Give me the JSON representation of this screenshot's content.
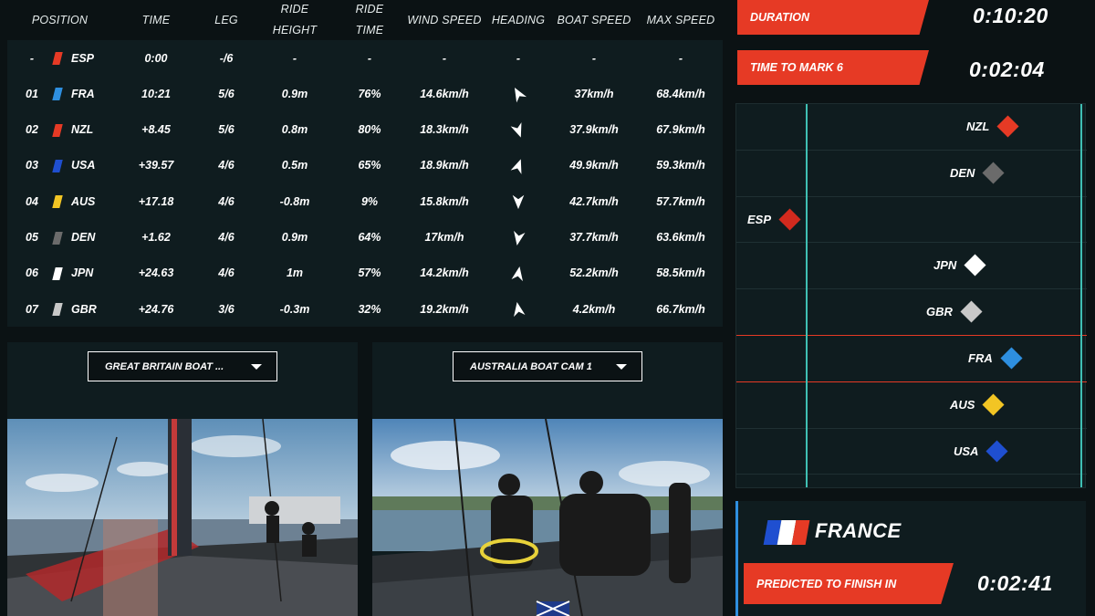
{
  "table": {
    "headers": {
      "position": "POSITION",
      "time": "TIME",
      "leg": "LEG",
      "ride_height_1": "RIDE",
      "ride_height_2": "HEIGHT",
      "ride_time_1": "RIDE",
      "ride_time_2": "TIME",
      "wind_speed": "WIND SPEED",
      "heading": "HEADING",
      "boat_speed": "BOAT SPEED",
      "max_speed": "MAX SPEED"
    },
    "rows": [
      {
        "pos": "-",
        "team": "ESP",
        "flag_color": "#e63a25",
        "time": "0:00",
        "leg": "-/6",
        "ride_height": "-",
        "ride_time": "-",
        "wind_speed": "-",
        "heading": "none",
        "boat_speed": "-",
        "max_speed": "-"
      },
      {
        "pos": "01",
        "team": "FRA",
        "flag_color": "#2e8fe0",
        "time": "10:21",
        "leg": "5/6",
        "ride_height": "0.9m",
        "ride_time": "76%",
        "wind_speed": "14.6km/h",
        "heading": "heading-arrow-icon",
        "boat_speed": "37km/h",
        "max_speed": "68.4km/h"
      },
      {
        "pos": "02",
        "team": "NZL",
        "flag_color": "#e63a25",
        "time": "+8.45",
        "leg": "5/6",
        "ride_height": "0.8m",
        "ride_time": "80%",
        "wind_speed": "18.3km/h",
        "heading": "heading-arrow-icon",
        "boat_speed": "37.9km/h",
        "max_speed": "67.9km/h"
      },
      {
        "pos": "03",
        "team": "USA",
        "flag_color": "#1f4fd0",
        "time": "+39.57",
        "leg": "4/6",
        "ride_height": "0.5m",
        "ride_time": "65%",
        "wind_speed": "18.9km/h",
        "heading": "heading-arrow-icon",
        "boat_speed": "49.9km/h",
        "max_speed": "59.3km/h"
      },
      {
        "pos": "04",
        "team": "AUS",
        "flag_color": "#f2c524",
        "time": "+17.18",
        "leg": "4/6",
        "ride_height": "-0.8m",
        "ride_time": "9%",
        "wind_speed": "15.8km/h",
        "heading": "heading-arrow-icon",
        "boat_speed": "42.7km/h",
        "max_speed": "57.7km/h"
      },
      {
        "pos": "05",
        "team": "DEN",
        "flag_color": "#6b6b6b",
        "time": "+1.62",
        "leg": "4/6",
        "ride_height": "0.9m",
        "ride_time": "64%",
        "wind_speed": "17km/h",
        "heading": "heading-arrow-icon",
        "boat_speed": "37.7km/h",
        "max_speed": "63.6km/h"
      },
      {
        "pos": "06",
        "team": "JPN",
        "flag_color": "#ffffff",
        "time": "+24.63",
        "leg": "4/6",
        "ride_height": "1m",
        "ride_time": "57%",
        "wind_speed": "14.2km/h",
        "heading": "heading-arrow-icon",
        "boat_speed": "52.2km/h",
        "max_speed": "58.5km/h"
      },
      {
        "pos": "07",
        "team": "GBR",
        "flag_color": "#c8c8c8",
        "time": "+24.76",
        "leg": "3/6",
        "ride_height": "-0.3m",
        "ride_time": "32%",
        "wind_speed": "19.2km/h",
        "heading": "heading-arrow-icon",
        "boat_speed": "4.2km/h",
        "max_speed": "66.7km/h"
      }
    ]
  },
  "cameras": {
    "left": {
      "selected": "GREAT BRITAIN BOAT ..."
    },
    "right": {
      "selected": "AUSTRALIA BOAT CAM 1"
    }
  },
  "info": {
    "duration_label": "DURATION",
    "duration_value": "0:10:20",
    "mark_label": "TIME TO MARK 6",
    "mark_value": "0:02:04"
  },
  "tracker": {
    "boats": [
      {
        "name": "NZL",
        "color": "#e63a25"
      },
      {
        "name": "DEN",
        "color": "#6b6b6b"
      },
      {
        "name": "ESP",
        "color": "#d22a1e"
      },
      {
        "name": "JPN",
        "color": "#ffffff"
      },
      {
        "name": "GBR",
        "color": "#c8c8c8"
      },
      {
        "name": "FRA",
        "color": "#2e8fe0"
      },
      {
        "name": "AUS",
        "color": "#f2c524"
      },
      {
        "name": "USA",
        "color": "#1f4fd0"
      }
    ]
  },
  "focus": {
    "country": "FRANCE",
    "predict_label": "PREDICTED TO FINISH IN",
    "predict_value": "0:02:41",
    "flag_colors": [
      "#1f4fd0",
      "#ffffff",
      "#e63a25"
    ]
  }
}
